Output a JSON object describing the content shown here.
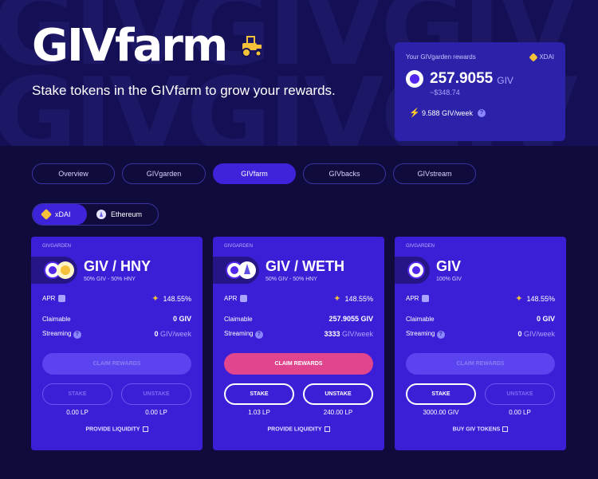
{
  "hero": {
    "title": "GIVfarm",
    "subtitle": "Stake tokens in the GIVfarm to grow your rewards.",
    "bg_rows": [
      "GIVGIVGIV",
      "GIVGIVGIV"
    ]
  },
  "rewards_card": {
    "label": "Your GIVgarden rewards",
    "network": "XDAI",
    "amount": "257.9055",
    "unit": "GIV",
    "usd": "~$348.74",
    "rate": "9.588 GIV/week"
  },
  "tabs": [
    "Overview",
    "GIVgarden",
    "GIVfarm",
    "GIVbacks",
    "GIVstream"
  ],
  "active_tab": "GIVfarm",
  "networks": [
    "xDAI",
    "Ethereum"
  ],
  "active_network": "xDAI",
  "cards": [
    {
      "tag": "GIVGARDEN",
      "name": "GIV / HNY",
      "composition": "50% GIV - 50% HNY",
      "apr_label": "APR",
      "apr": "148.55%",
      "claimable_label": "Claimable",
      "claimable": "0 GIV",
      "streaming_label": "Streaming",
      "streaming": "0",
      "streaming_unit": "GIV/week",
      "claim_label": "CLAIM REWARDS",
      "stake_label": "STAKE",
      "unstake_label": "UNSTAKE",
      "stake_amount": "0.00 LP",
      "unstake_amount": "0.00 LP",
      "link": "PROVIDE LIQUIDITY"
    },
    {
      "tag": "GIVGARDEN",
      "name": "GIV / WETH",
      "composition": "50% GIV - 50% HNY",
      "apr_label": "APR",
      "apr": "148.55%",
      "claimable_label": "Claimable",
      "claimable": "257.9055 GIV",
      "streaming_label": "Streaming",
      "streaming": "3333",
      "streaming_unit": "GIV/week",
      "claim_label": "CLAIM REWARDS",
      "stake_label": "STAKE",
      "unstake_label": "UNSTAKE",
      "stake_amount": "1.03 LP",
      "unstake_amount": "240.00 LP",
      "link": "PROVIDE LIQUIDITY"
    },
    {
      "tag": "GIVGARDEN",
      "name": "GIV",
      "composition": "100% GIV",
      "apr_label": "APR",
      "apr": "148.55%",
      "claimable_label": "Claimable",
      "claimable": "0 GIV",
      "streaming_label": "Streaming",
      "streaming": "0",
      "streaming_unit": "GIV/week",
      "claim_label": "CLAIM REWARDS",
      "stake_label": "STAKE",
      "unstake_label": "UNSTAKE",
      "stake_amount": "3000.00 GIV",
      "unstake_amount": "0.00 LP",
      "link": "BUY GIV TOKENS"
    }
  ],
  "colors": {
    "background": "#0f0b3d",
    "card": "#3b1fd6",
    "accent": "#e1458d",
    "tab_active": "#3d23d9"
  }
}
